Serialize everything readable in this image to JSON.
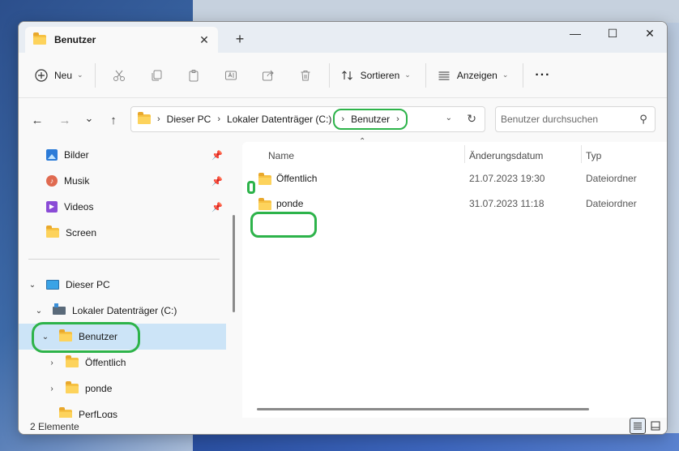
{
  "window": {
    "tab_title": "Benutzer",
    "tab_close": "✕",
    "new_tab": "+",
    "minimize": "—",
    "maximize": "☐",
    "close": "✕"
  },
  "toolbar": {
    "new_label": "Neu",
    "sort_label": "Sortieren",
    "view_label": "Anzeigen",
    "more_label": "···"
  },
  "nav": {
    "back": "←",
    "forward": "→",
    "recent": "⌄",
    "up": "↑"
  },
  "address": {
    "crumbs": [
      "Dieser PC",
      "Lokaler Datenträger (C:)",
      "Benutzer"
    ]
  },
  "search": {
    "placeholder": "Benutzer durchsuchen"
  },
  "sidebar": {
    "quick_access": [
      {
        "label": "Bilder",
        "icon": "pictures-icon",
        "pinned": true
      },
      {
        "label": "Musik",
        "icon": "music-icon",
        "pinned": true
      },
      {
        "label": "Videos",
        "icon": "videos-icon",
        "pinned": true
      },
      {
        "label": "Screen",
        "icon": "folder-icon",
        "pinned": false
      }
    ],
    "tree": [
      {
        "label": "Dieser PC",
        "icon": "pc-icon",
        "level": 0,
        "expanded": true
      },
      {
        "label": "Lokaler Datenträger (C:)",
        "icon": "drive-icon",
        "level": 1,
        "expanded": true
      },
      {
        "label": "Benutzer",
        "icon": "folder-icon",
        "level": 2,
        "expanded": true,
        "selected": true
      },
      {
        "label": "Öffentlich",
        "icon": "folder-icon",
        "level": 3,
        "expanded": false
      },
      {
        "label": "ponde",
        "icon": "folder-icon",
        "level": 3,
        "expanded": false
      },
      {
        "label": "PerfLogs",
        "icon": "folder-icon",
        "level": 2,
        "expanded": false
      }
    ]
  },
  "columns": {
    "name": "Name",
    "date": "Änderungsdatum",
    "type": "Typ"
  },
  "files": [
    {
      "name": "Öffentlich",
      "date": "21.07.2023 19:30",
      "type": "Dateiordner"
    },
    {
      "name": "ponde",
      "date": "31.07.2023 11:18",
      "type": "Dateiordner"
    }
  ],
  "status": {
    "count": "2 Elemente"
  },
  "colors": {
    "highlight": "#2db34a",
    "selection": "#cce4f7",
    "folder": "#f6c142"
  }
}
